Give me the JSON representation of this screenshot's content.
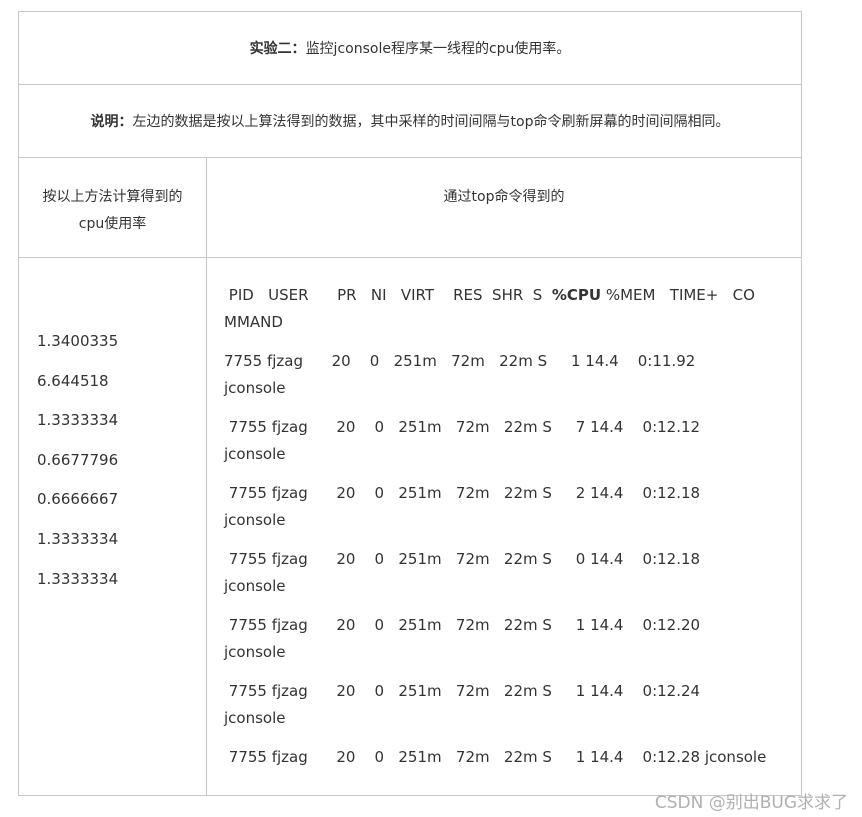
{
  "experiment": {
    "label": "实验二：",
    "text": "监控jconsole程序某一线程的cpu使用率。"
  },
  "note": {
    "label": "说明：",
    "text": "左边的数据是按以上算法得到的数据，其中采样的时间间隔与top命令刷新屏幕的时间间隔相同。"
  },
  "headers": {
    "left_line1": "按以上方法计算得到的",
    "left_line2": "cpu使用率",
    "right": "通过top命令得到的"
  },
  "computed_values": [
    "1.3400335",
    "6.644518",
    "1.3333334",
    "0.6677796",
    "0.6666667",
    "1.3333334",
    "1.3333334"
  ],
  "top_output": {
    "header_pre": " PID   USER      PR   NI   VIRT    RES  SHR  S  ",
    "header_cpu": "%CPU",
    "header_post": " %MEM   TIME+   CO",
    "header_line2": "MMAND",
    "rows": [
      {
        "line1": "7755 fjzag      20    0   251m   72m   22m S     1 14.4    0:11.92",
        "line2": "jconsole"
      },
      {
        "line1": " 7755 fjzag      20    0   251m   72m   22m S     7 14.4    0:12.12",
        "line2": "jconsole"
      },
      {
        "line1": " 7755 fjzag      20    0   251m   72m   22m S     2 14.4    0:12.18",
        "line2": "jconsole"
      },
      {
        "line1": " 7755 fjzag      20    0   251m   72m   22m S     0 14.4    0:12.18",
        "line2": "jconsole"
      },
      {
        "line1": " 7755 fjzag      20    0   251m   72m   22m S     1 14.4    0:12.20",
        "line2": "jconsole"
      },
      {
        "line1": " 7755 fjzag      20    0   251m   72m   22m S     1 14.4    0:12.24",
        "line2": "jconsole"
      },
      {
        "line1": " 7755 fjzag      20    0   251m   72m   22m S     1 14.4    0:12.28 jconsole",
        "line2": ""
      }
    ]
  },
  "watermark": "CSDN @别出BUG求求了"
}
